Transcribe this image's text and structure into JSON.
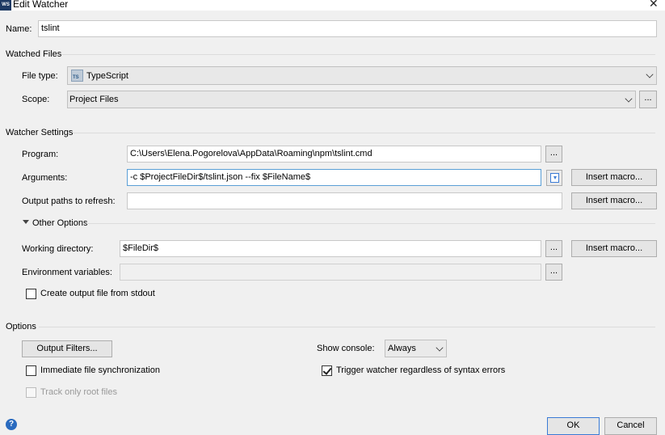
{
  "window": {
    "title": "Edit Watcher",
    "app_icon": "WS",
    "close_glyph": "✕"
  },
  "name": {
    "label": "Name:",
    "value": "tslint"
  },
  "watched_files": {
    "header": "Watched Files",
    "file_type_label": "File type:",
    "file_type_value": "TypeScript",
    "file_type_icon_text": "TS",
    "scope_label": "Scope:",
    "scope_value": "Project Files",
    "scope_browse": "..."
  },
  "watcher_settings": {
    "header": "Watcher Settings",
    "program_label": "Program:",
    "program_value": "C:\\Users\\Elena.Pogorelova\\AppData\\Roaming\\npm\\tslint.cmd",
    "program_browse": "...",
    "arguments_label": "Arguments:",
    "arguments_value": "-c $ProjectFileDir$/tslint.json --fix $FileName$",
    "insert_macro": "Insert macro...",
    "output_paths_label": "Output paths to refresh:",
    "output_paths_value": "",
    "other_options": "Other Options",
    "working_dir_label": "Working directory:",
    "working_dir_value": "$FileDir$",
    "working_dir_browse": "...",
    "env_vars_label": "Environment variables:",
    "env_vars_value": "",
    "env_vars_browse": "...",
    "create_output_label": "Create output file from stdout"
  },
  "options": {
    "header": "Options",
    "output_filters": "Output Filters...",
    "show_console_label": "Show console:",
    "show_console_value": "Always",
    "immediate_sync_label": "Immediate file synchronization",
    "trigger_label": "Trigger watcher regardless of syntax errors",
    "track_root_label": "Track only root files"
  },
  "footer": {
    "help": "?",
    "ok": "OK",
    "cancel": "Cancel"
  },
  "colors": {
    "accent": "#3a7bd5",
    "background": "#f0f0f0"
  }
}
